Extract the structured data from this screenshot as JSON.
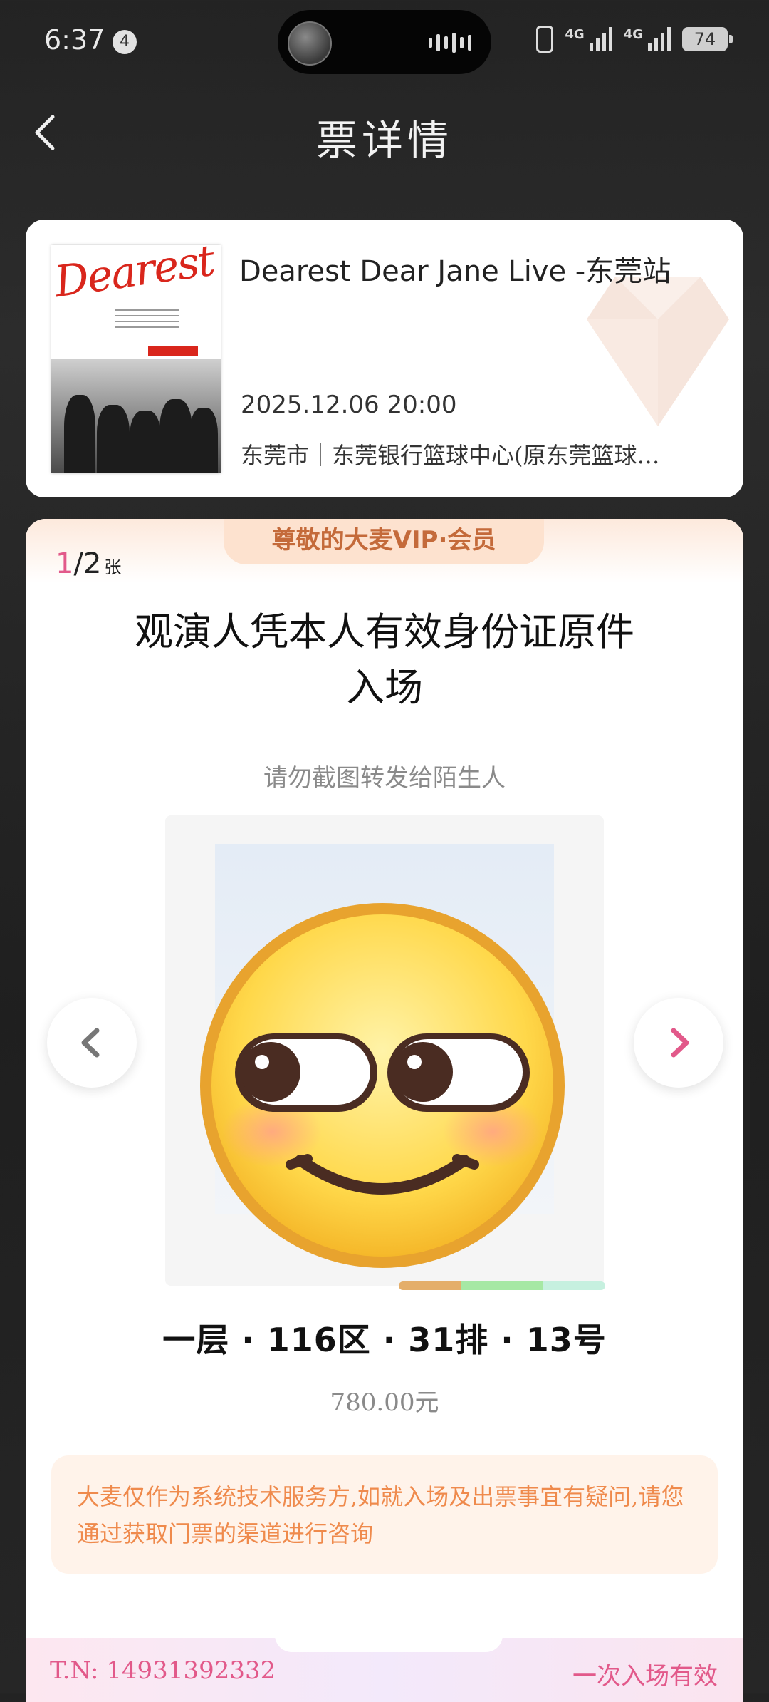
{
  "status_bar": {
    "time": "6:37",
    "notification_count": "4",
    "network_1": "4G",
    "network_2": "4G",
    "battery": "74"
  },
  "header": {
    "title": "票详情",
    "back_icon": "chevron-left-icon"
  },
  "event": {
    "poster_logo": "Dearest",
    "title": "Dearest Dear Jane Live -东莞站",
    "datetime": "2025.12.06 20:00",
    "venue": "东莞市｜东莞银行篮球中心(原东莞篮球…"
  },
  "ticket": {
    "vip_banner": "尊敬的大麦VIP·会员",
    "count_current": "1",
    "count_separator": "/",
    "count_total": "2",
    "count_unit": "张",
    "entry_notice_line1": "观演人凭本人有效身份证原件",
    "entry_notice_line2": "入场",
    "no_screenshot_notice": "请勿截图转发给陌生人",
    "qr_cover_icon": "smiling-face-emoji-icon",
    "seat": "一层 · 116区 · 31排 · 13号",
    "price": "780.00元",
    "disclaimer": "大麦仅作为系统技术服务方,如就入场及出票事宜有疑问,请您通过获取门票的渠道进行咨询",
    "tn": "T.N:  14931392332",
    "valid_note": "一次入场有效"
  },
  "colors": {
    "accent_pink": "#e2598a",
    "vip_text": "#c46a3a",
    "disclaimer_text": "#ef8a4c"
  }
}
